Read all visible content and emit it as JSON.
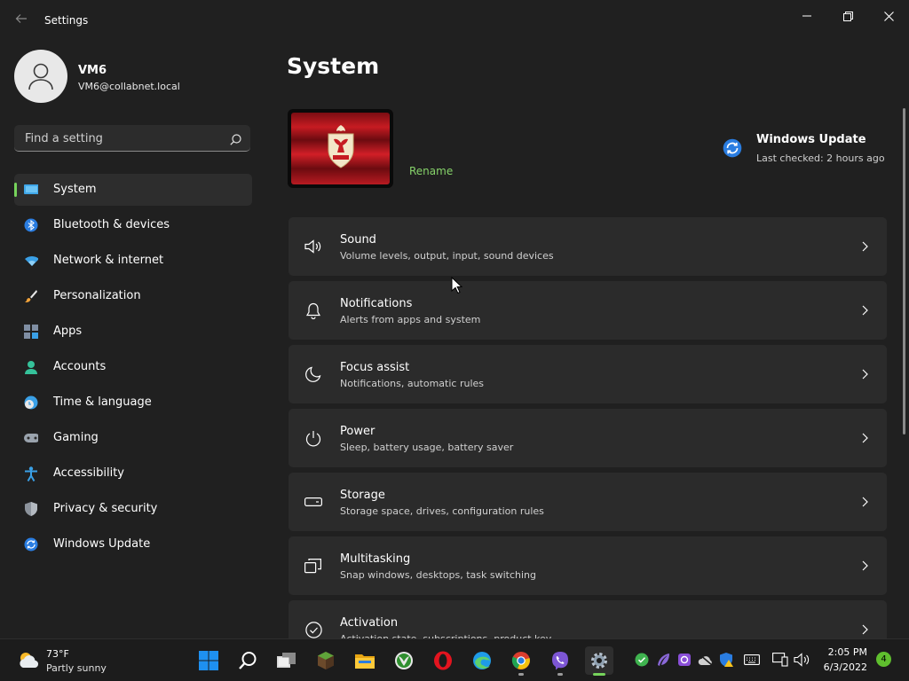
{
  "window": {
    "title": "Settings"
  },
  "profile": {
    "name": "VM6",
    "email": "VM6@collabnet.local"
  },
  "search": {
    "placeholder": "Find a setting"
  },
  "nav": [
    {
      "label": "System",
      "icon": "monitor-icon",
      "active": true
    },
    {
      "label": "Bluetooth & devices",
      "icon": "bluetooth-icon"
    },
    {
      "label": "Network & internet",
      "icon": "wifi-icon"
    },
    {
      "label": "Personalization",
      "icon": "brush-icon"
    },
    {
      "label": "Apps",
      "icon": "apps-icon"
    },
    {
      "label": "Accounts",
      "icon": "person-icon"
    },
    {
      "label": "Time & language",
      "icon": "clock-globe-icon"
    },
    {
      "label": "Gaming",
      "icon": "gamepad-icon"
    },
    {
      "label": "Accessibility",
      "icon": "accessibility-icon"
    },
    {
      "label": "Privacy & security",
      "icon": "shield-icon"
    },
    {
      "label": "Windows Update",
      "icon": "sync-icon"
    }
  ],
  "main": {
    "title": "System",
    "rename": "Rename",
    "windows_update": {
      "title": "Windows Update",
      "subtitle": "Last checked: 2 hours ago"
    },
    "items": [
      {
        "title": "Sound",
        "subtitle": "Volume levels, output, input, sound devices",
        "icon": "speaker-icon"
      },
      {
        "title": "Notifications",
        "subtitle": "Alerts from apps and system",
        "icon": "bell-icon"
      },
      {
        "title": "Focus assist",
        "subtitle": "Notifications, automatic rules",
        "icon": "moon-icon"
      },
      {
        "title": "Power",
        "subtitle": "Sleep, battery usage, battery saver",
        "icon": "power-icon"
      },
      {
        "title": "Storage",
        "subtitle": "Storage space, drives, configuration rules",
        "icon": "drive-icon"
      },
      {
        "title": "Multitasking",
        "subtitle": "Snap windows, desktops, task switching",
        "icon": "multitask-icon"
      },
      {
        "title": "Activation",
        "subtitle": "Activation state, subscriptions, product key",
        "icon": "check-circle-icon"
      }
    ]
  },
  "taskbar": {
    "weather": {
      "temp": "73°F",
      "condition": "Partly sunny"
    },
    "clock": {
      "time": "2:05 PM",
      "date": "6/3/2022"
    },
    "notifications": "4"
  },
  "colors": {
    "accent": "#76d35b",
    "link": "#86d36a",
    "background": "#202020",
    "card": "#2b2b2b"
  }
}
